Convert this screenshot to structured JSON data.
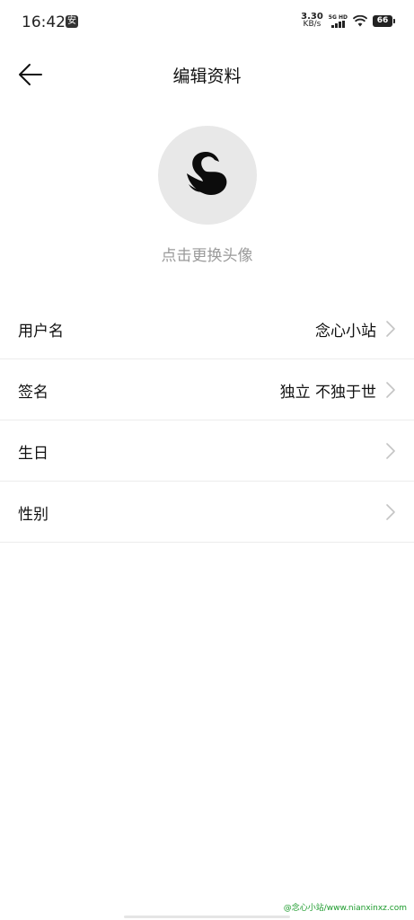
{
  "status_bar": {
    "time": "16:42",
    "app_badge": "安",
    "net_speed_value": "3.30",
    "net_speed_unit": "KB/s",
    "signal_label": "5G HD",
    "battery": "66"
  },
  "nav": {
    "title": "编辑资料"
  },
  "avatar": {
    "hint": "点击更换头像"
  },
  "form": {
    "rows": [
      {
        "label": "用户名",
        "value": "念心小站"
      },
      {
        "label": "签名",
        "value": "独立 不独于世"
      },
      {
        "label": "生日",
        "value": ""
      },
      {
        "label": "性别",
        "value": ""
      }
    ]
  },
  "watermark": "@念心小站/www.nianxinxz.com",
  "colors": {
    "text_primary": "#111111",
    "text_hint": "#9a9a9a",
    "divider": "#ececec",
    "avatar_bg": "#e8e8e8",
    "watermark": "#1a9a2a"
  }
}
